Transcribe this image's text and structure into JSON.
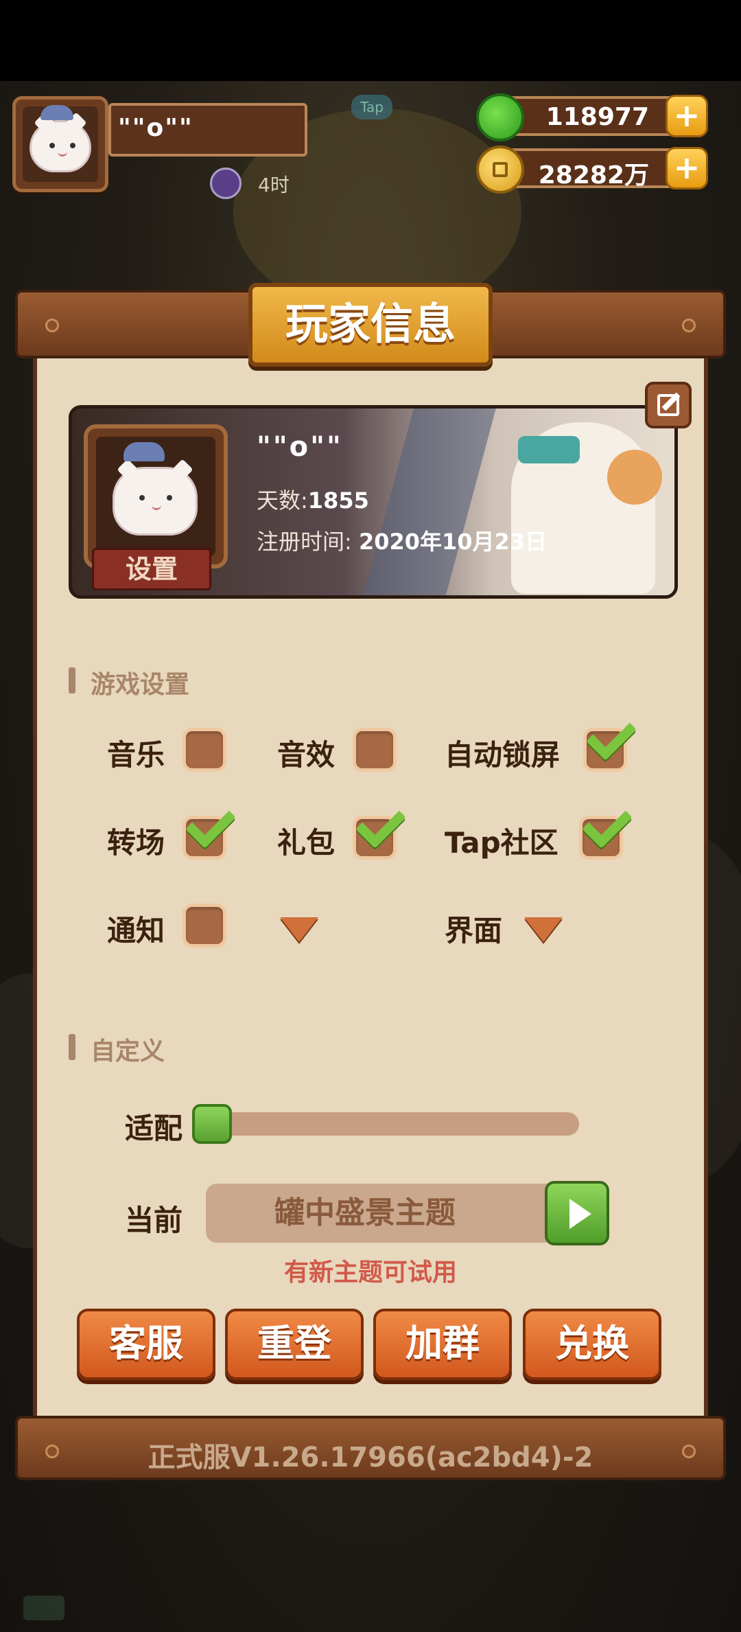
{
  "player": {
    "name": "\"\"o\"\"",
    "level_time": "4时"
  },
  "hud": {
    "tap_bubble": "Tap",
    "jade": "118977",
    "coins": "28282万",
    "plus_symbol": "+"
  },
  "panel": {
    "title": "玩家信息",
    "version": "正式服V1.26.17966(ac2bd4)-2"
  },
  "profile": {
    "name": "\"\"o\"\"",
    "days_label": "天数:",
    "days_value": "1855",
    "register_label": "注册时间:",
    "register_value": "2020年10月23日",
    "set_button": "设置"
  },
  "game_settings": {
    "heading": "游戏设置",
    "options": [
      {
        "label": "音乐",
        "checked": false
      },
      {
        "label": "音效",
        "checked": false
      },
      {
        "label": "自动锁屏",
        "checked": true
      },
      {
        "label": "转场",
        "checked": true
      },
      {
        "label": "礼包",
        "checked": true
      },
      {
        "label": "Tap社区",
        "checked": true
      },
      {
        "label": "通知",
        "checked": false
      },
      {
        "label": "界面",
        "type": "dropdown"
      }
    ]
  },
  "custom": {
    "heading": "自定义",
    "adapt_label": "适配",
    "adapt_level": 0,
    "current_label": "当前",
    "current_theme": "罐中盛景主题",
    "hint": "有新主题可试用"
  },
  "actions": {
    "service": "客服",
    "relogin": "重登",
    "join_group": "加群",
    "redeem": "兑换"
  },
  "colors": {
    "accent_orange": "#d2581e",
    "check_green": "#7ac53d",
    "panel_bg": "#e8d8bd",
    "hint_red": "#d15a4a"
  }
}
